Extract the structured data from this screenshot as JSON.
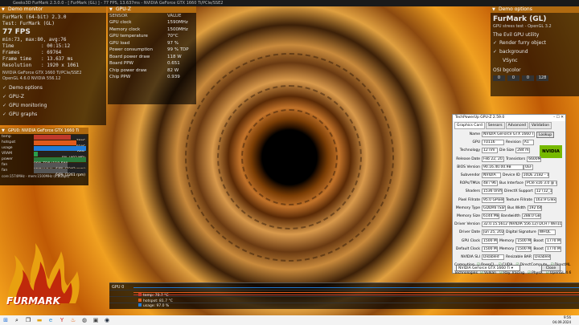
{
  "window_title": "Geeks3D FurMark 2.3.0.0 - [ FurMark (GL) ] - 77 FPS, 13.637ms - NVIDIA GeForce GTX 1660 Ti/PCIe/SSE2",
  "demo": {
    "header": "Demo monitor",
    "line1": "FurMark (64-bit) 2.3.0",
    "line2": "Test: FurMark (GL)",
    "fps": "77 FPS",
    "minmax": "min:73, max:80, avg:76",
    "stats": [
      {
        "k": "Time",
        "v": "00:15:12"
      },
      {
        "k": "Frames",
        "v": "69764"
      },
      {
        "k": "Frame time",
        "v": "13.637 ms"
      },
      {
        "k": "Resolution",
        "v": "1920 x 1061"
      }
    ],
    "gpu_name": "NVIDIA GeForce GTX 1660 Ti/PCIe/SSE2",
    "gl_ver": "OpenGL 4.6.0 NVIDIA 556.12",
    "checks": [
      "Demo options",
      "GPU-Z",
      "GPU monitoring",
      "GPU graphs"
    ]
  },
  "gpuz_overlay": {
    "header": "GPU-Z",
    "col1": "SENSOR",
    "col2": "VALUE",
    "rows": [
      {
        "k": "GPU clock",
        "v": "1590MHz"
      },
      {
        "k": "Memory clock",
        "v": "1500MHz"
      },
      {
        "k": "GPU temperature",
        "v": "70°C"
      },
      {
        "k": "GPU load",
        "v": "97 %"
      },
      {
        "k": "Power consumption",
        "v": "99 % TDP"
      },
      {
        "k": "Board power draw",
        "v": "118 W"
      },
      {
        "k": "Board PPW",
        "v": "0.651"
      },
      {
        "k": "Chip power draw",
        "v": "82 W"
      },
      {
        "k": "Chip PPW",
        "v": "0.939"
      }
    ]
  },
  "gpu_panel": {
    "header": "GPU0: NVIDIA GeForce GTX 1660 Ti",
    "bars": [
      {
        "k": "temp",
        "v": "70°C",
        "pct": 0.7,
        "color": "#c0392b"
      },
      {
        "k": "hotspot",
        "v": "81°C",
        "pct": 0.81,
        "color": "#e05a1a"
      },
      {
        "k": "usage",
        "v": "98%",
        "pct": 0.98,
        "color": "#1f7bd6"
      },
      {
        "k": "VRAM",
        "v": "8% (483 MB)",
        "pct": 0.08,
        "color": "#2a9d4a"
      },
      {
        "k": "power",
        "v": "99% TDP (118.5W) · PPW:0.651",
        "pct": 0.99,
        "color": "#2a7a3a"
      },
      {
        "k": "fan",
        "v": "64% (2242 rpm)",
        "pct": 0.64,
        "color": "#555555"
      },
      {
        "k": "fan",
        "v": "64% (2261 rpm)",
        "pct": 0.64,
        "color": "#555555"
      }
    ],
    "footer": "core:1574MHz - mem:1500MHz (4.8Gbps)"
  },
  "furmark": {
    "header": "Demo options",
    "title": "FurMark (GL)",
    "sub": "GPU stress test - OpenGL 3.2",
    "util": "The Evil GPU utility",
    "checks": [
      "Render furry object",
      "background"
    ],
    "vsync": "VSync",
    "osi_label": "OSI bgcolor",
    "osi_values": [
      "0",
      "0",
      "0",
      "128"
    ]
  },
  "gpuz": {
    "title": "TechPowerUp GPU-Z 2.59.0",
    "tabs": [
      "Graphics Card",
      "Sensors",
      "Advanced",
      "Validation"
    ],
    "name": "NVIDIA GeForce GTX 1660 Ti",
    "lookup": "Lookup",
    "gpu": "TU116",
    "revision_label": "Revision",
    "revision": "A1",
    "technology": "12 nm",
    "die_size_label": "Die Size",
    "die_size": "284 mm²",
    "release": "Feb 22, 2019",
    "transistors_label": "Transistors",
    "transistors": "6600M",
    "bios": "90.16.40.00.9B",
    "uefi": "UEFI",
    "subvendor": "NVIDIA",
    "device_id_label": "Device ID",
    "device_id": "10DE 2182 - 10DE 2182",
    "rops": "48 / 96",
    "bus_label": "Bus Interface",
    "bus": "PCIe x16 3.0 @ x16 3.0",
    "shaders": "1536 Unified",
    "dx_label": "DirectX Support",
    "dx": "12 (12_1)",
    "pixel": "95.0 GPixel/s",
    "texture_label": "Texture Fillrate",
    "texture": "163.9 GTexel/s",
    "memtype": "GDDR6 (Samsung)",
    "buswidth_label": "Bus Width",
    "buswidth": "192 bit",
    "memsize": "6144 MB",
    "bandwidth_label": "Bandwidth",
    "bandwidth": "288.0 GB/s",
    "driver": "32.0.15.5612 (NVIDIA 556.12) DCH / Win10 64",
    "driverdate": "Jun 25, 2024",
    "sig_label": "Digital Signature",
    "sig": "WHQL",
    "gpuclock": "1500 MHz",
    "memlabel": "Memory",
    "mem1": "1500 MHz",
    "boostlabel": "Boost",
    "boost1": "1770 MHz",
    "defclock": "1500 MHz",
    "mem2": "1500 MHz",
    "boost2": "1770 MHz",
    "sli": "Disabled",
    "rbar_label": "Resizable BAR",
    "rbar": "Disabled",
    "computing": [
      "OpenCL",
      "CUDA",
      "DirectCompute",
      "DirectML"
    ],
    "technologies": [
      "Vulkan",
      "Ray Tracing",
      "PhysX",
      "OpenGL 4.6"
    ],
    "labels": {
      "name": "Name",
      "gpu": "GPU",
      "technology": "Technology",
      "release": "Release Date",
      "bios": "BIOS Version",
      "subvendor": "Subvendor",
      "rops": "ROPs/TMUs",
      "shaders": "Shaders",
      "pixel": "Pixel Fillrate",
      "memtype": "Memory Type",
      "memsize": "Memory Size",
      "driver": "Driver Version",
      "driverdate": "Driver Date",
      "gpuclock": "GPU Clock",
      "defclock": "Default Clock",
      "sli": "NVIDIA SLI",
      "computing": "Computing",
      "technologies": "Technologies"
    },
    "bottom_select": "NVIDIA GeForce GTX 1660 Ti",
    "close": "Close",
    "logo": "NVIDIA"
  },
  "graph": {
    "label": "GPU 0",
    "legend": [
      "temp: 70.7 °C",
      "hotspot: 81.7 °C",
      "usage: 97.0 %"
    ]
  },
  "logo_text": "FURMARK",
  "taskbar": {
    "time": "9:56",
    "date": "04.09.2024"
  }
}
